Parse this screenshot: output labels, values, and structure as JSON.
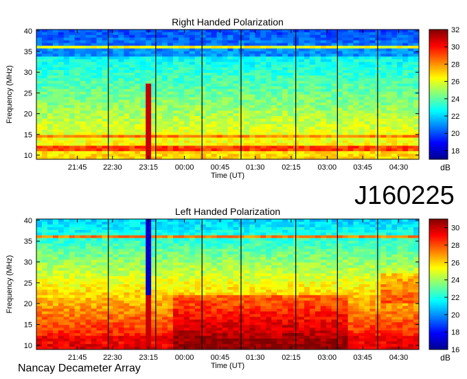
{
  "observation_id": "J160225",
  "instrument": "Nancay Decameter Array",
  "colors": {
    "colormap": [
      "#00008f",
      "#0000ff",
      "#0080ff",
      "#00ffff",
      "#80ff80",
      "#ffff00",
      "#ff8000",
      "#ff0000",
      "#800000"
    ],
    "frame": "#000000",
    "time_marker": "#000000"
  },
  "chart_data": [
    {
      "type": "heatmap",
      "title": "Right Handed Polarization",
      "xlabel": "Time (UT)",
      "ylabel": "Frequency (MHz)",
      "x_ticks": [
        "21:45",
        "22:30",
        "23:15",
        "00:00",
        "00:45",
        "01:30",
        "02:15",
        "03:00",
        "03:45",
        "04:30"
      ],
      "y_ticks": [
        10,
        15,
        20,
        25,
        30,
        35,
        40
      ],
      "ylim": [
        9,
        40.3
      ],
      "colorbar": {
        "label": "dB",
        "range": [
          17,
          32
        ],
        "ticks": [
          18,
          20,
          22,
          24,
          26,
          28,
          30,
          32
        ]
      },
      "vertical_markers": [
        0.188,
        0.312,
        0.433,
        0.535,
        0.678,
        0.787,
        0.892
      ],
      "bright_burst_time_fraction": 0.298,
      "features": [
        {
          "frequency_mhz": 11.5,
          "level_db": 30
        },
        {
          "frequency_mhz": 14.5,
          "level_db": 29
        },
        {
          "frequency_mhz": 36,
          "level_db": 27
        }
      ]
    },
    {
      "type": "heatmap",
      "title": "Left Handed Polarization",
      "xlabel": "Time (UT)",
      "ylabel": "Frequency (MHz)",
      "x_ticks": [
        "21:45",
        "22:30",
        "23:15",
        "00:00",
        "00:45",
        "01:30",
        "02:15",
        "03:00",
        "03:45",
        "04:30"
      ],
      "y_ticks": [
        10,
        15,
        20,
        25,
        30,
        35,
        40
      ],
      "ylim": [
        9,
        40.3
      ],
      "colorbar": {
        "label": "dB",
        "range": [
          16,
          31
        ],
        "ticks": [
          16,
          18,
          20,
          22,
          24,
          26,
          28,
          30
        ]
      },
      "vertical_markers": [
        0.188,
        0.312,
        0.433,
        0.535,
        0.678,
        0.787,
        0.892
      ],
      "bright_burst_time_fraction": 0.298,
      "features": [
        {
          "frequency_mhz": 11.5,
          "level_db": 30
        },
        {
          "frequency_mhz": 36,
          "level_db": 28
        }
      ]
    }
  ]
}
